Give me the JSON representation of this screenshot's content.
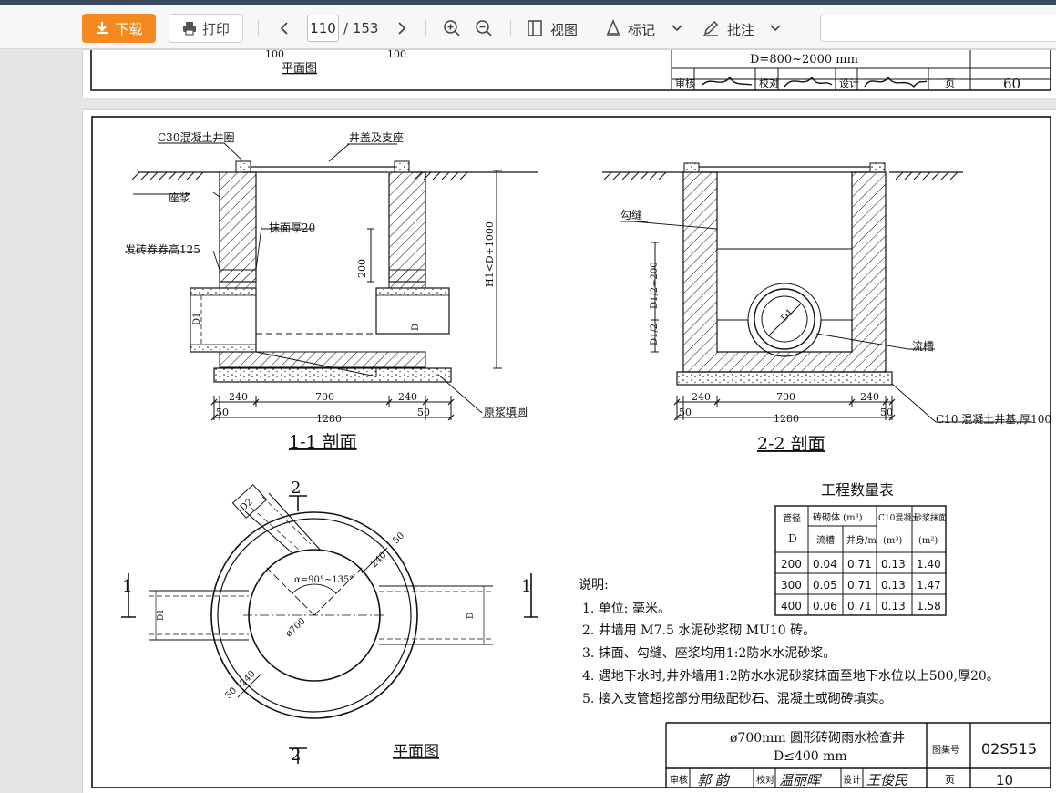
{
  "toolbar": {
    "download_label": "下载",
    "print_label": "打印",
    "current_page": "110",
    "total_pages": "/ 153",
    "view_label": "视图",
    "mark_label": "标记",
    "annotate_label": "批注"
  },
  "prev_page": {
    "grade_text": "D=800~2000  mm",
    "dim_left": "100",
    "dim_right": "100",
    "plan_label": "平面图",
    "review_label": "审核",
    "check_label": "校对",
    "design_label": "设计",
    "page_label": "页",
    "page_no": "60"
  },
  "drawing": {
    "sec11": {
      "label_ring": "C30混凝土井圈",
      "label_cover": "井盖及支座",
      "label_mortar": "座浆",
      "label_plaster": "抹面厚20",
      "label_arch": "发砖券券高125",
      "label_base": "原浆填圆",
      "dim_200": "200",
      "dim_height": "H1<D+1000",
      "dim_d1": "D1",
      "dim_d": "D",
      "dim_240a": "240",
      "dim_700": "700",
      "dim_240b": "240",
      "dim_50a": "50",
      "dim_1280": "1280",
      "dim_50b": "50",
      "title": "1-1 剖面"
    },
    "sec22": {
      "label_joint": "勾缝",
      "label_channel": "流槽",
      "label_base": "C10 混凝土井基,厚100",
      "dim_d1_half": "D1/2+200",
      "dim_d_half": "D1/2",
      "dim_d1": "D1",
      "dim_240a": "240",
      "dim_700": "700",
      "dim_240b": "240",
      "dim_50a": "50",
      "dim_1280": "1280",
      "dim_50b": "50",
      "title": "2-2 剖面"
    },
    "plan": {
      "cut_mark_top": "2",
      "cut_mark_bottom": "2",
      "cut_left": "1",
      "cut_right": "1",
      "dim_d2": "D2",
      "dim_angle": "α=90°~135°",
      "dim_diam": "ø700",
      "dim_240_outer": "240",
      "dim_50_outer": "50",
      "dim_240_inner": "240",
      "dim_50_inner": "50",
      "dim_d1": "D1",
      "dim_d": "D",
      "title": "平面图"
    },
    "table": {
      "title": "工程数量表",
      "head_pipe": "管径",
      "head_d": "D",
      "head_brick": "砖砌体 (m³)",
      "head_channel": "流槽",
      "head_wall": "井身/m",
      "head_concrete": "C10混凝土",
      "head_concrete_unit": "(m³)",
      "head_plaster": "砂浆抹面",
      "head_plaster_unit": "(m²)",
      "rows": [
        [
          "200",
          "0.04",
          "0.71",
          "0.13",
          "1.40"
        ],
        [
          "300",
          "0.05",
          "0.71",
          "0.13",
          "1.47"
        ],
        [
          "400",
          "0.06",
          "0.71",
          "0.13",
          "1.58"
        ]
      ]
    },
    "notes": {
      "heading": "说明:",
      "items": [
        "1. 单位: 毫米。",
        "2. 井墙用 M7.5 水泥砂浆砌 MU10 砖。",
        "3. 抹面、勾缝、座浆均用1:2防水水泥砂浆。",
        "4. 遇地下水时,井外墙用1:2防水水泥砂浆抹面至地下水位以上500,厚20。",
        "5. 接入支管超挖部分用级配砂石、混凝土或砌砖填实。"
      ]
    },
    "title_block": {
      "title_line1": "ø700mm 圆形砖砌雨水检查井",
      "title_line2": "D≤400 mm",
      "atlas_label": "图集号",
      "atlas_no": "02S515",
      "review_label": "审核",
      "review_sig": "郭 韵",
      "check_label": "校对",
      "check_sig": "温丽晖",
      "design_label": "设计",
      "design_sig": "王俊民",
      "page_label": "页",
      "page_no": "10"
    }
  }
}
